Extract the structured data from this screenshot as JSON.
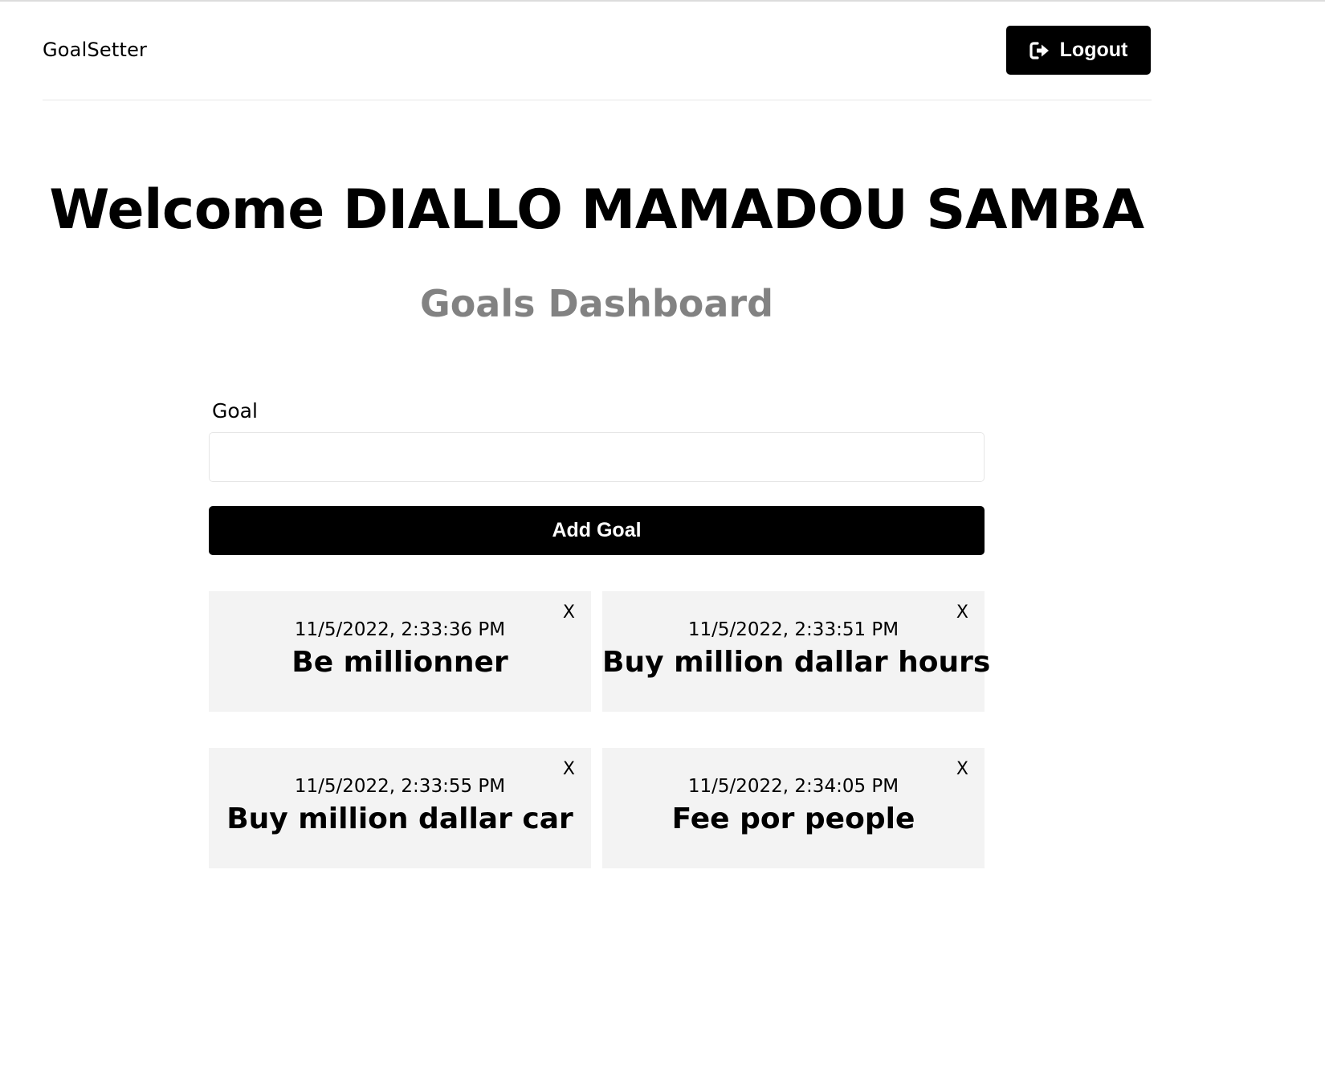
{
  "header": {
    "brand": "GoalSetter",
    "logout_label": "Logout",
    "logout_icon": "sign-out-icon"
  },
  "main": {
    "welcome": "Welcome DIALLO MAMADOU SAMBA",
    "subtitle": "Goals Dashboard"
  },
  "form": {
    "goal_label": "Goal",
    "goal_value": "",
    "add_button_label": "Add Goal"
  },
  "goals": [
    {
      "date": "11/5/2022, 2:33:36 PM",
      "text": "Be millionner",
      "close_label": "X"
    },
    {
      "date": "11/5/2022, 2:33:51 PM",
      "text": "Buy million dallar hours",
      "close_label": "X"
    },
    {
      "date": "11/5/2022, 2:33:55 PM",
      "text": "Buy million dallar car",
      "close_label": "X"
    },
    {
      "date": "11/5/2022, 2:34:05 PM",
      "text": "Fee por people",
      "close_label": "X"
    }
  ]
}
